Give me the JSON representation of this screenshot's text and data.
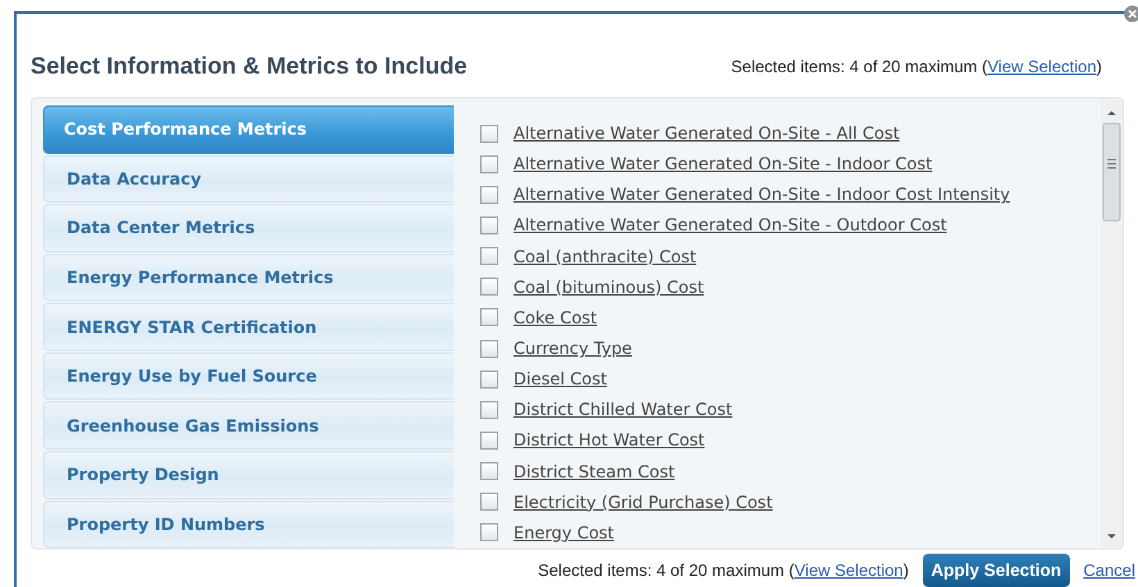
{
  "dialog": {
    "title": "Select Information & Metrics to Include"
  },
  "header_selection": {
    "prefix": "Selected items: 4 of 20 maximum (",
    "link": "View Selection",
    "suffix": ")"
  },
  "categories": [
    {
      "label": "Cost Performance Metrics",
      "selected": true
    },
    {
      "label": "Data Accuracy",
      "selected": false
    },
    {
      "label": "Data Center Metrics",
      "selected": false
    },
    {
      "label": "Energy Performance Metrics",
      "selected": false
    },
    {
      "label": "ENERGY STAR Certification",
      "selected": false
    },
    {
      "label": "Energy Use by Fuel Source",
      "selected": false
    },
    {
      "label": "Greenhouse Gas Emissions",
      "selected": false
    },
    {
      "label": "Property Design",
      "selected": false
    },
    {
      "label": "Property ID Numbers",
      "selected": false
    }
  ],
  "metrics": [
    {
      "label": "Alternative Water Generated On-Site - All Cost",
      "checked": false
    },
    {
      "label": "Alternative Water Generated On-Site - Indoor Cost",
      "checked": false
    },
    {
      "label": "Alternative Water Generated On-Site - Indoor Cost Intensity",
      "checked": false
    },
    {
      "label": "Alternative Water Generated On-Site - Outdoor Cost",
      "checked": false
    },
    {
      "label": "Coal (anthracite) Cost",
      "checked": false
    },
    {
      "label": "Coal (bituminous) Cost",
      "checked": false
    },
    {
      "label": "Coke Cost",
      "checked": false
    },
    {
      "label": "Currency Type",
      "checked": false
    },
    {
      "label": "Diesel Cost",
      "checked": false
    },
    {
      "label": "District Chilled Water Cost",
      "checked": false
    },
    {
      "label": "District Hot Water Cost",
      "checked": false
    },
    {
      "label": "District Steam Cost",
      "checked": false
    },
    {
      "label": "Electricity (Grid Purchase) Cost",
      "checked": false
    },
    {
      "label": "Energy Cost",
      "checked": false
    }
  ],
  "footer": {
    "selection": {
      "prefix": "Selected items: 4 of 20 maximum (",
      "link": "View Selection",
      "suffix": ")"
    },
    "apply_button": "Apply Selection",
    "cancel_link": "Cancel"
  }
}
